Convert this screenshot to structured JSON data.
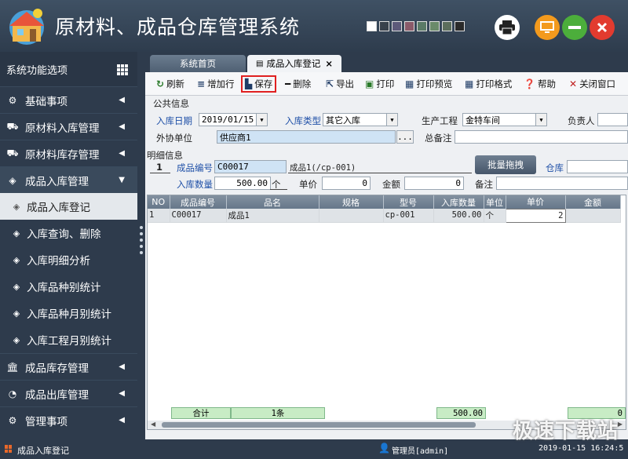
{
  "app": {
    "title": "原材料、成品仓库管理系统"
  },
  "header": {
    "swatch_colors": [
      "#ffffff",
      "#38414b",
      "#5d5a7a",
      "#8a5a6a",
      "#5a7a66",
      "#6a8a6a",
      "#5c6e5c",
      "#2a2a2a"
    ],
    "print_icon": "print-icon",
    "monitor_icon": "monitor-icon",
    "minimize_icon": "minimize-icon",
    "close_icon": "close-icon"
  },
  "sidebar": {
    "title": "系统功能选项",
    "items": [
      {
        "label": "基础事项",
        "icon": "gear-icon"
      },
      {
        "label": "原材料入库管理",
        "icon": "truck-icon"
      },
      {
        "label": "原材料库存管理",
        "icon": "truck-icon"
      },
      {
        "label": "成品入库管理",
        "icon": "cube-icon",
        "open": true,
        "children": [
          "成品入库登记",
          "入库查询、删除",
          "入库明细分析",
          "入库品种别统计",
          "入库品种月别统计",
          "入库工程月别统计"
        ]
      },
      {
        "label": "成品库存管理",
        "icon": "bank-icon"
      },
      {
        "label": "成品出库管理",
        "icon": "pie-icon"
      },
      {
        "label": "管理事项",
        "icon": "gear-icon"
      }
    ]
  },
  "tabs": {
    "home": "系统首页",
    "current": "成品入库登记"
  },
  "toolbar": {
    "refresh": "刷新",
    "add_row": "增加行",
    "save": "保存",
    "delete": "删除",
    "export": "导出",
    "print": "打印",
    "print_preview": "打印预览",
    "print_format": "打印格式",
    "help": "帮助",
    "close_window": "关闭窗口"
  },
  "public_info": {
    "section": "公共信息",
    "date_label": "入库日期",
    "date_value": "2019/01/15",
    "type_label": "入库类型",
    "type_value": "其它入库",
    "workshop_label": "生产工程",
    "workshop_value": "金特车间",
    "owner_label": "负责人",
    "owner_value": "",
    "partner_label": "外协单位",
    "partner_value": "供应商1",
    "partner_btn": "...",
    "remark_label": "总备注",
    "remark_value": ""
  },
  "detail_info": {
    "section": "明细信息",
    "row_no": "1",
    "code_label": "成品编号",
    "code_value": "C00017",
    "code_desc": "成品1(/cp-001)",
    "qty_label": "入库数量",
    "qty_value": "500.00",
    "qty_unit": "个",
    "price_label": "单价",
    "price_value": "0",
    "amount_label": "金额",
    "amount_value": "0",
    "note_label": "备注",
    "note_value": "",
    "batch_button": "批量拖拽",
    "warehouse_label": "仓库",
    "warehouse_value": ""
  },
  "grid": {
    "headers": [
      "NO",
      "成品编号",
      "品名",
      "规格",
      "型号",
      "入库数量",
      "单位",
      "单价",
      "金额"
    ],
    "rows": [
      [
        "1",
        "C00017",
        "成品1",
        "",
        "cp-001",
        "500.00",
        "个",
        "2",
        ""
      ]
    ],
    "totals": {
      "label": "合计",
      "count": "1条",
      "qty": "500.00",
      "amount": "0"
    }
  },
  "status": {
    "module": "成品入库登记",
    "user": "管理员[admin]",
    "datetime": "2019-01-15 16:24:5"
  },
  "watermark": "极速下载站"
}
